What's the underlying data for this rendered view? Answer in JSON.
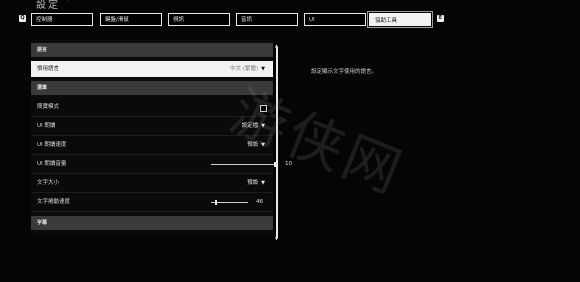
{
  "header": {
    "title": "設定",
    "caret": "▾"
  },
  "tabs": {
    "left_key": "Q",
    "right_key": "E",
    "items": [
      {
        "label": "控制器"
      },
      {
        "label": "鍵盤/滑鼠"
      },
      {
        "label": "視訊"
      },
      {
        "label": "音訊"
      },
      {
        "label": "UI"
      },
      {
        "label": "協助工具"
      }
    ],
    "active_index": 5
  },
  "sections": {
    "language": {
      "header": "語言",
      "rows": [
        {
          "label": "慣用語言",
          "value": "中文 (繁體)",
          "arrow": "▼"
        }
      ]
    },
    "menu": {
      "header": "選單",
      "rows": [
        {
          "label": "簡寶模式",
          "checked": false
        },
        {
          "label": "UI 朗讀",
          "value": "設定檔",
          "arrow": "▼"
        },
        {
          "label": "UI 朗讀速度",
          "value": "預設",
          "arrow": "▼"
        },
        {
          "label": "UI 朗讀音量",
          "value": "10",
          "level": 1.0
        },
        {
          "label": "文字大小",
          "value": "預設",
          "arrow": "▼"
        },
        {
          "label": "文字捲動速度",
          "value": "46",
          "level": 0.46
        }
      ]
    },
    "subtitles": {
      "header": "字幕"
    }
  },
  "description": "設定顯示文字使用的語言。",
  "watermark": "游侠网"
}
